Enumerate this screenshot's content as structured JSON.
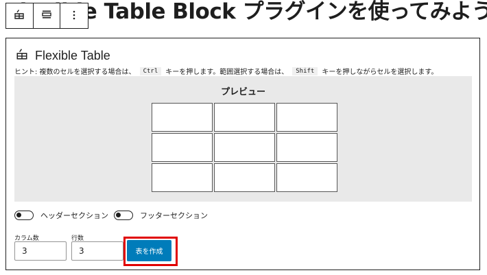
{
  "page": {
    "title": "Flexible Table Block プラグインを使ってみよう"
  },
  "toolbar": {
    "buttons": [
      {
        "icon": "flexible-table-icon"
      },
      {
        "icon": "align-icon"
      },
      {
        "icon": "more-options-icon"
      }
    ]
  },
  "block": {
    "icon": "flexible-table-icon",
    "title": "Flexible Table",
    "hint": {
      "prefix": "ヒント: 複数のセルを選択する場合は、",
      "key1": "Ctrl",
      "middle": "キーを押します。範囲選択する場合は、",
      "key2": "Shift",
      "suffix": "キーを押しながらセルを選択します。"
    },
    "preview": {
      "title": "プレビュー",
      "rows": 3,
      "cols": 3
    },
    "toggles": {
      "header_label": "ヘッダーセクション",
      "header_on": false,
      "footer_label": "フッターセクション",
      "footer_on": false
    },
    "columns": {
      "label": "カラム数",
      "value": "3"
    },
    "rows": {
      "label": "行数",
      "value": "3"
    },
    "create_button": "表を作成"
  },
  "colors": {
    "primary_button": "#007cba",
    "highlight_border": "#e00000",
    "preview_background": "#e9e9e9"
  }
}
